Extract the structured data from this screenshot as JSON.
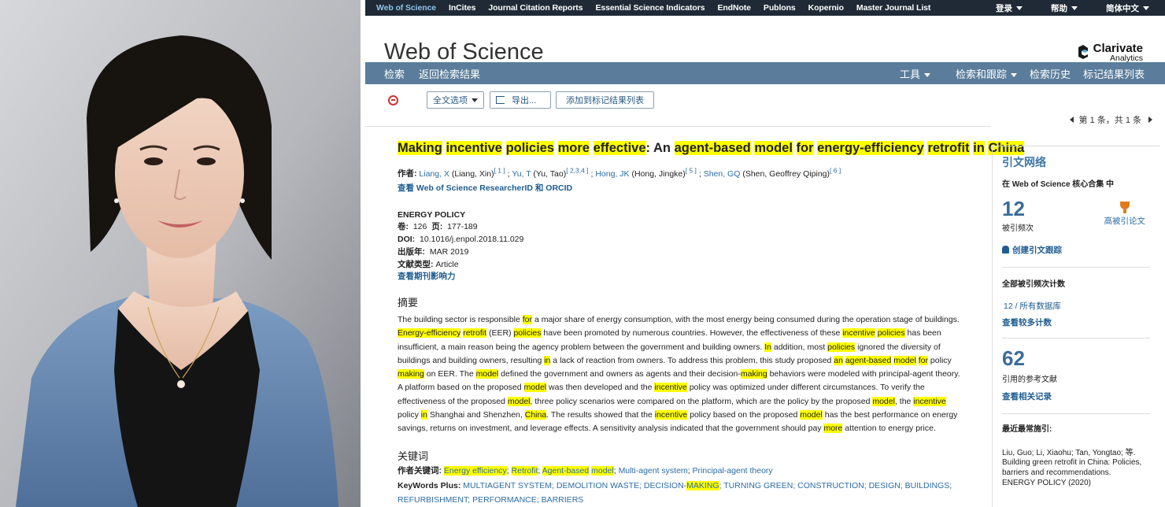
{
  "topnav": {
    "links": [
      "Web of Science",
      "InCites",
      "Journal Citation Reports",
      "Essential Science Indicators",
      "EndNote",
      "Publons",
      "Kopernio",
      "Master Journal List"
    ],
    "right": [
      "登录",
      "帮助",
      "简体中文"
    ]
  },
  "brand": {
    "title": "Web of Science",
    "logo_line1": "Clarivate",
    "logo_line2": "Analytics"
  },
  "bluebar": {
    "left": [
      "检索",
      "返回检索结果"
    ],
    "right": [
      "工具",
      "检索和跟踪",
      "检索历史",
      "标记结果列表"
    ]
  },
  "toolbar": {
    "fulltext": "全文选项",
    "export": "导出...",
    "add_marked": "添加到标记结果列表",
    "pager": "第 1 条，共 1 条"
  },
  "record": {
    "title_parts": [
      {
        "t": "Making",
        "h": true
      },
      {
        "t": " ",
        "h": false
      },
      {
        "t": "incentive",
        "h": true
      },
      {
        "t": " ",
        "h": false
      },
      {
        "t": "policies",
        "h": true
      },
      {
        "t": " ",
        "h": false
      },
      {
        "t": "more",
        "h": true
      },
      {
        "t": " ",
        "h": false
      },
      {
        "t": "effective",
        "h": true
      },
      {
        "t": ": An ",
        "h": false
      },
      {
        "t": "agent-based",
        "h": true
      },
      {
        "t": " ",
        "h": false
      },
      {
        "t": "model",
        "h": true
      },
      {
        "t": " ",
        "h": false
      },
      {
        "t": "for",
        "h": true
      },
      {
        "t": " ",
        "h": false
      },
      {
        "t": "energy-efficiency",
        "h": true
      },
      {
        "t": " ",
        "h": false
      },
      {
        "t": "retrofit",
        "h": true
      },
      {
        "t": " ",
        "h": false
      },
      {
        "t": "in",
        "h": true
      },
      {
        "t": " ",
        "h": false
      },
      {
        "t": "China",
        "h": true
      }
    ],
    "authors_label": "作者:",
    "authors": [
      {
        "short": "Liang, X",
        "full": " (Liang, Xin)",
        "sup": "[ 1 ]"
      },
      {
        "short": "Yu, T",
        "full": " (Yu, Tao)",
        "sup": "[ 2,3,4 ]"
      },
      {
        "short": "Hong, JK",
        "full": " (Hong, Jingke)",
        "sup": "[ 5 ]"
      },
      {
        "short": "Shen, GQ",
        "full": " (Shen, Geoffrey Qiping)",
        "sup": "[ 6 ]"
      }
    ],
    "researcher_link": "查看 Web of Science ResearcherID 和 ORCID",
    "journal": "ENERGY POLICY",
    "vol_label": "卷:",
    "vol": "126",
    "page_label": "页:",
    "pages": "177-189",
    "doi_label": "DOI:",
    "doi": "10.1016/j.enpol.2018.11.029",
    "date_label": "出版年:",
    "date": "MAR 2019",
    "type_label": "文献类型:",
    "type": "Article",
    "impact_link": "查看期刊影响力",
    "abstract_heading": "摘要",
    "abstract_parts": [
      {
        "t": "The building sector is responsible ",
        "h": false
      },
      {
        "t": "for",
        "h": true
      },
      {
        "t": " a major share of energy consumption, with the most energy being consumed during the operation stage of buildings. ",
        "h": false
      },
      {
        "t": "Energy-efficiency",
        "h": true
      },
      {
        "t": " ",
        "h": false
      },
      {
        "t": "retrofit",
        "h": true
      },
      {
        "t": " (EER) ",
        "h": false
      },
      {
        "t": "policies",
        "h": true
      },
      {
        "t": " have been promoted by numerous countries. However, the effectiveness of these ",
        "h": false
      },
      {
        "t": "incentive",
        "h": true
      },
      {
        "t": " ",
        "h": false
      },
      {
        "t": "policies",
        "h": true
      },
      {
        "t": " has been insufficient, a main reason being the agency problem between the government and building owners. ",
        "h": false
      },
      {
        "t": "In",
        "h": true
      },
      {
        "t": " addition, most ",
        "h": false
      },
      {
        "t": "policies",
        "h": true
      },
      {
        "t": " ignored the diversity of buildings and building owners, resulting ",
        "h": false
      },
      {
        "t": "in",
        "h": true
      },
      {
        "t": " a lack of reaction from owners. To address this problem, this study proposed ",
        "h": false
      },
      {
        "t": "an",
        "h": true
      },
      {
        "t": " ",
        "h": false
      },
      {
        "t": "agent-based",
        "h": true
      },
      {
        "t": " ",
        "h": false
      },
      {
        "t": "model",
        "h": true
      },
      {
        "t": " ",
        "h": false
      },
      {
        "t": "for",
        "h": true
      },
      {
        "t": " policy ",
        "h": false
      },
      {
        "t": "making",
        "h": true
      },
      {
        "t": " on EER. The ",
        "h": false
      },
      {
        "t": "model",
        "h": true
      },
      {
        "t": " defined the government and owners as agents and their decision-",
        "h": false
      },
      {
        "t": "making",
        "h": true
      },
      {
        "t": " behaviors were modeled with principal-agent theory. A platform based on the proposed ",
        "h": false
      },
      {
        "t": "model",
        "h": true
      },
      {
        "t": " was then developed and the ",
        "h": false
      },
      {
        "t": "incentive",
        "h": true
      },
      {
        "t": " policy was optimized under different circumstances. To verify the effectiveness of the proposed ",
        "h": false
      },
      {
        "t": "model",
        "h": true
      },
      {
        "t": ", three policy scenarios were compared on the platform, which are the policy by the proposed ",
        "h": false
      },
      {
        "t": "model",
        "h": true
      },
      {
        "t": ", the ",
        "h": false
      },
      {
        "t": "incentive",
        "h": true
      },
      {
        "t": " policy ",
        "h": false
      },
      {
        "t": "in",
        "h": true
      },
      {
        "t": " Shanghai and Shenzhen, ",
        "h": false
      },
      {
        "t": "China",
        "h": true
      },
      {
        "t": ". The results showed that the ",
        "h": false
      },
      {
        "t": "incentive",
        "h": true
      },
      {
        "t": " policy based on the proposed ",
        "h": false
      },
      {
        "t": "model",
        "h": true
      },
      {
        "t": " has the best performance on energy savings, returns on investment, and leverage effects. A sensitivity analysis indicated that the government should pay ",
        "h": false
      },
      {
        "t": "more",
        "h": true
      },
      {
        "t": " attention to energy price.",
        "h": false
      }
    ],
    "keywords_heading": "关键词",
    "author_kw_label": "作者关键词:",
    "author_kw_parts": [
      {
        "t": "Energy efficiency",
        "h": true
      },
      {
        "t": "; ",
        "h": false,
        "p": true
      },
      {
        "t": "Retrofit",
        "h": true
      },
      {
        "t": "; ",
        "h": false,
        "p": true
      },
      {
        "t": "Agent-based",
        "h": true
      },
      {
        "t": " ",
        "h": false
      },
      {
        "t": "model",
        "h": true
      },
      {
        "t": "; ",
        "h": false,
        "p": true
      },
      {
        "t": "Multi-agent system",
        "h": false
      },
      {
        "t": "; ",
        "h": false,
        "p": true
      },
      {
        "t": "Principal-agent theory",
        "h": false
      }
    ],
    "plus_label": "KeyWords Plus:",
    "plus_parts": [
      {
        "t": "MULTIAGENT SYSTEM; DEMOLITION WASTE; DECISION-",
        "h": false
      },
      {
        "t": "MAKING",
        "h": true
      },
      {
        "t": "; TURNING GREEN; CONSTRUCTION; DESIGN; BUILDINGS; REFURBISHMENT; PERFORMANCE; BARRIERS",
        "h": false
      }
    ]
  },
  "sidebar": {
    "heading": "引文网络",
    "scope": "在 Web of Science 核心合集 中",
    "times_cited": "12",
    "times_cited_label": "被引频次",
    "highly_cited": "高被引论文",
    "create_alert": "创建引文跟踪",
    "all_counts_heading": "全部被引频次计数",
    "all_counts": "12 / 所有数据库",
    "more_counts": "查看较多计数",
    "refs": "62",
    "refs_label": "引用的参考文献",
    "related": "查看相关记录",
    "recent_heading": "最近最常施引:",
    "recent_authors": "Liu, Guo; Li, Xiaohu; Tan, Yongtao; 等.",
    "recent_title": "Building green retrofit in China: Policies, barriers and recommendations.",
    "recent_source": "ENERGY POLICY (2020)"
  }
}
